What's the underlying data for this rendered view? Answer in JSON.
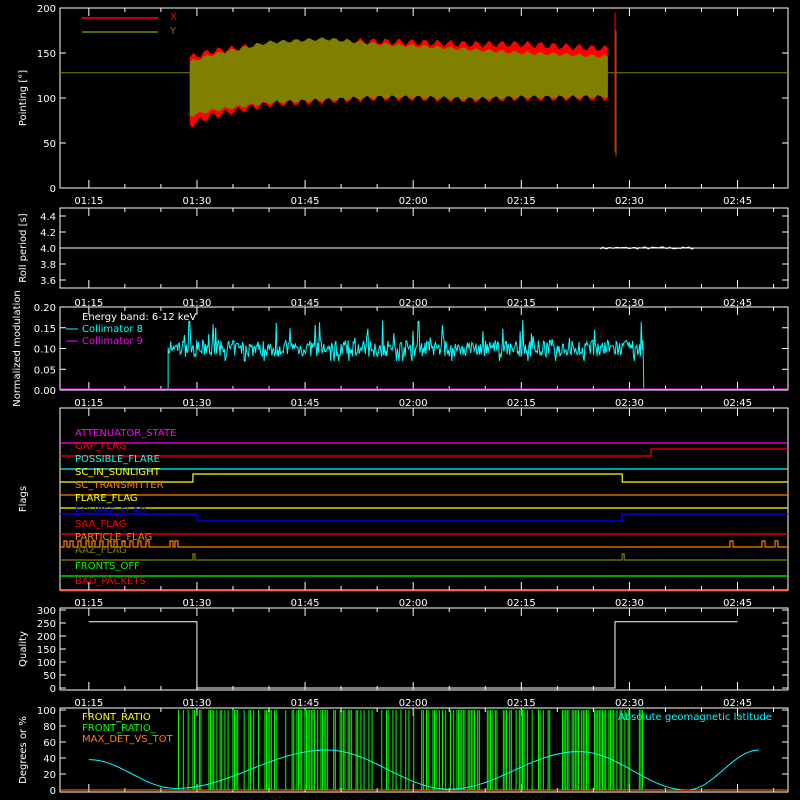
{
  "chart_data": [
    {
      "id": "pointing",
      "type": "area",
      "ylabel": "Pointing [°]",
      "ylim": [
        0,
        200
      ],
      "yticks": [
        0,
        50,
        100,
        150,
        200
      ],
      "xticks": [
        "01:15",
        "01:30",
        "01:45",
        "02:00",
        "02:15",
        "02:30",
        "02:45"
      ],
      "legend": [
        {
          "name": "X",
          "color": "#ff0000"
        },
        {
          "name": "Y",
          "color": "#808000"
        }
      ],
      "baseline": 128,
      "series": [
        {
          "name": "X",
          "color": "#ff0000",
          "time": [
            "01:29",
            "01:32",
            "01:40",
            "01:48",
            "01:55",
            "02:00",
            "02:08",
            "02:15",
            "02:22",
            "02:27"
          ],
          "low": [
            70,
            80,
            93,
            97,
            100,
            100,
            98,
            100,
            100,
            100
          ],
          "high": [
            145,
            152,
            160,
            163,
            163,
            162,
            160,
            160,
            157,
            155
          ]
        },
        {
          "name": "Y",
          "color": "#808000",
          "time": [
            "01:29",
            "01:32",
            "01:40",
            "01:48",
            "01:55",
            "02:00",
            "02:08",
            "02:15",
            "02:22",
            "02:27"
          ],
          "low": [
            80,
            86,
            95,
            98,
            101,
            101,
            99,
            101,
            101,
            102
          ],
          "high": [
            140,
            148,
            162,
            166,
            160,
            158,
            154,
            150,
            148,
            146
          ]
        }
      ]
    },
    {
      "id": "roll",
      "type": "line",
      "ylabel": "Roll period [s]",
      "ylim": [
        3.5,
        4.5
      ],
      "yticks": [
        "3.6",
        "3.8",
        "4.0",
        "4.2",
        "4.4"
      ],
      "xticks": [
        "01:15",
        "01:30",
        "01:45",
        "02:00",
        "02:15",
        "02:30",
        "02:45"
      ],
      "series": [
        {
          "name": "Roll period",
          "color": "#ffffff",
          "x": [
            "01:15",
            "02:45"
          ],
          "y": [
            4.0,
            4.0
          ]
        }
      ]
    },
    {
      "id": "modulation",
      "type": "line",
      "ylabel": "Normalized modulation",
      "ylim": [
        0,
        0.2
      ],
      "yticks": [
        "0.00",
        "0.05",
        "0.10",
        "0.15",
        "0.20"
      ],
      "xticks": [
        "01:15",
        "01:30",
        "01:45",
        "02:00",
        "02:15",
        "02:30",
        "02:45"
      ],
      "legend": [
        {
          "name": "Energy band: 6-12 keV",
          "color": "#ffffff"
        },
        {
          "name": "Collimator 8",
          "color": "#00ffff"
        },
        {
          "name": "Collimator 9",
          "color": "#ff00ff"
        }
      ],
      "series": [
        {
          "name": "Collimator 8",
          "color": "#00ffff",
          "start": "01:26",
          "end": "02:32",
          "mean": 0.1,
          "range": [
            0.07,
            0.16
          ]
        },
        {
          "name": "Collimator 9",
          "color": "#ff00ff",
          "x": [
            "01:15",
            "02:45"
          ],
          "y": [
            0,
            0
          ]
        }
      ]
    },
    {
      "id": "flags",
      "type": "line",
      "ylabel": "Flags",
      "xticks": [
        "01:15",
        "01:30",
        "01:45",
        "02:00",
        "02:15",
        "02:30",
        "02:45"
      ],
      "flags": [
        {
          "name": "ATTENUATOR_STATE",
          "color": "#ff00ff"
        },
        {
          "name": "GAP_FLAG",
          "color": "#ff0000"
        },
        {
          "name": "POSSIBLE_FLARE",
          "color": "#00ffff"
        },
        {
          "name": "SC_IN_SUNLIGHT",
          "color": "#ffff00"
        },
        {
          "name": "SC_TRANSMITTER",
          "color": "#ff8000"
        },
        {
          "name": "FLARE_FLAG",
          "color": "#ffff00"
        },
        {
          "name": "ECLIPSE_FLAG",
          "color": "#0000ff"
        },
        {
          "name": "SAA_FLAG",
          "color": "#ff0000"
        },
        {
          "name": "PARTICLE_FLAG",
          "color": "#ff8000"
        },
        {
          "name": "AAZ_FLAG",
          "color": "#808000"
        },
        {
          "name": "FRONTS_OFF",
          "color": "#00ff00"
        },
        {
          "name": "BAD_PACKETS",
          "color": "#ff0000"
        }
      ]
    },
    {
      "id": "quality",
      "type": "line",
      "ylabel": "Quality",
      "ylim": [
        0,
        300
      ],
      "yticks": [
        "0",
        "50",
        "100",
        "150",
        "200",
        "250",
        "300"
      ],
      "xticks": [
        "01:15",
        "01:30",
        "01:45",
        "02:00",
        "02:15",
        "02:30",
        "02:45"
      ],
      "series": [
        {
          "name": "Quality",
          "color": "#ffffff",
          "x": [
            "01:15",
            "01:30",
            "01:30",
            "02:28",
            "02:28",
            "02:45"
          ],
          "y": [
            255,
            255,
            0,
            0,
            255,
            255
          ]
        }
      ]
    },
    {
      "id": "geomag",
      "type": "line",
      "ylabel": "Degrees or %",
      "ylim": [
        0,
        100
      ],
      "yticks": [
        "0",
        "20",
        "40",
        "60",
        "80",
        "100"
      ],
      "legend_left": [
        {
          "name": "FRONT_RATIO",
          "color": "#ffff00"
        },
        {
          "name": "FRONT_RATIO_",
          "color": "#00ff00"
        },
        {
          "name": "MAX_DET_VS_TOT",
          "color": "#ff8000"
        }
      ],
      "legend_right": {
        "name": "Absolute geomagnetic latitude",
        "color": "#00ffff"
      },
      "series": [
        {
          "name": "Absolute geomagnetic latitude",
          "color": "#00ffff",
          "x": [
            "01:15",
            "01:27",
            "01:48",
            "02:05",
            "02:23",
            "02:38",
            "02:48"
          ],
          "y": [
            38,
            2,
            50,
            1,
            48,
            0,
            50
          ]
        }
      ]
    }
  ]
}
